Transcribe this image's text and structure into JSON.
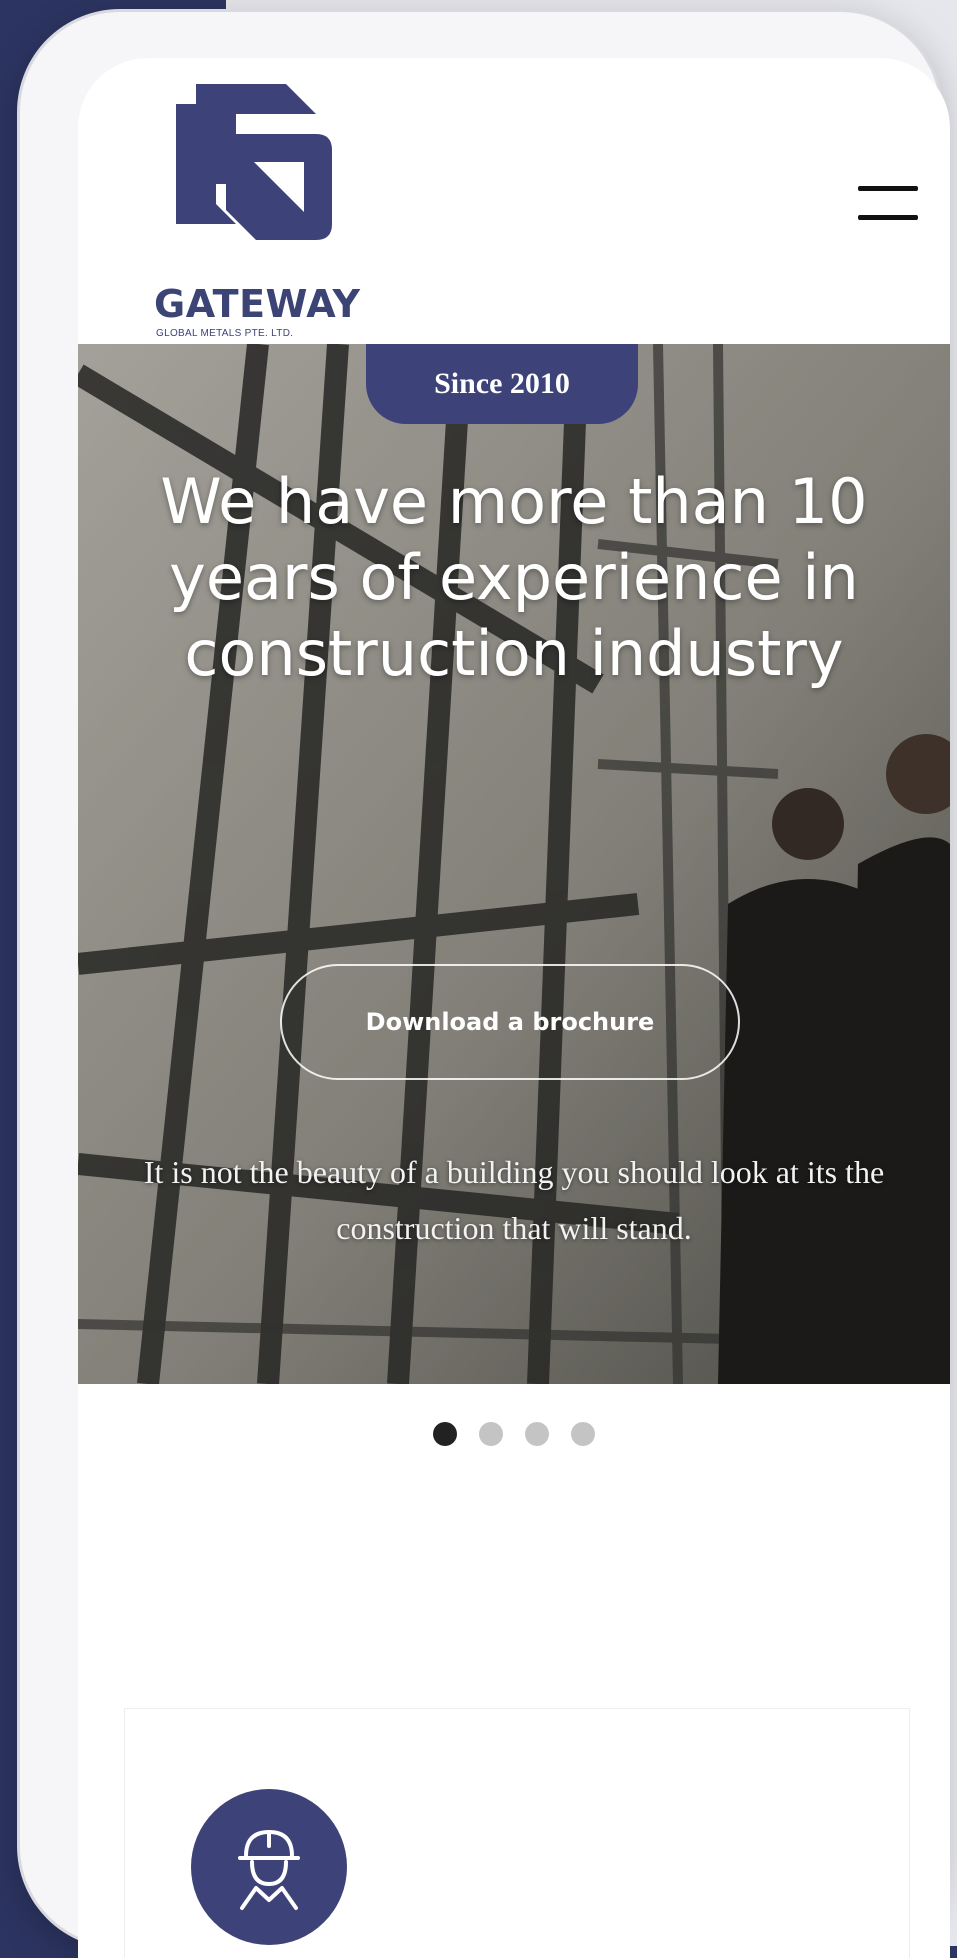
{
  "brand": {
    "name": "GATEWAY",
    "subtitle": "GLOBAL METALS PTE. LTD.",
    "color": "#3d4278"
  },
  "header": {
    "menu_icon": "hamburger-menu-icon"
  },
  "hero": {
    "badge": "Since 2010",
    "headline": "We have more than 10 years of experience in construction industry",
    "button_label": "Download a brochure",
    "tagline": "It is not the beauty of a building you should look at its the construction that will stand."
  },
  "carousel": {
    "slides": 4,
    "active_index": 0
  },
  "service_card": {
    "icon": "construction-worker-icon"
  }
}
